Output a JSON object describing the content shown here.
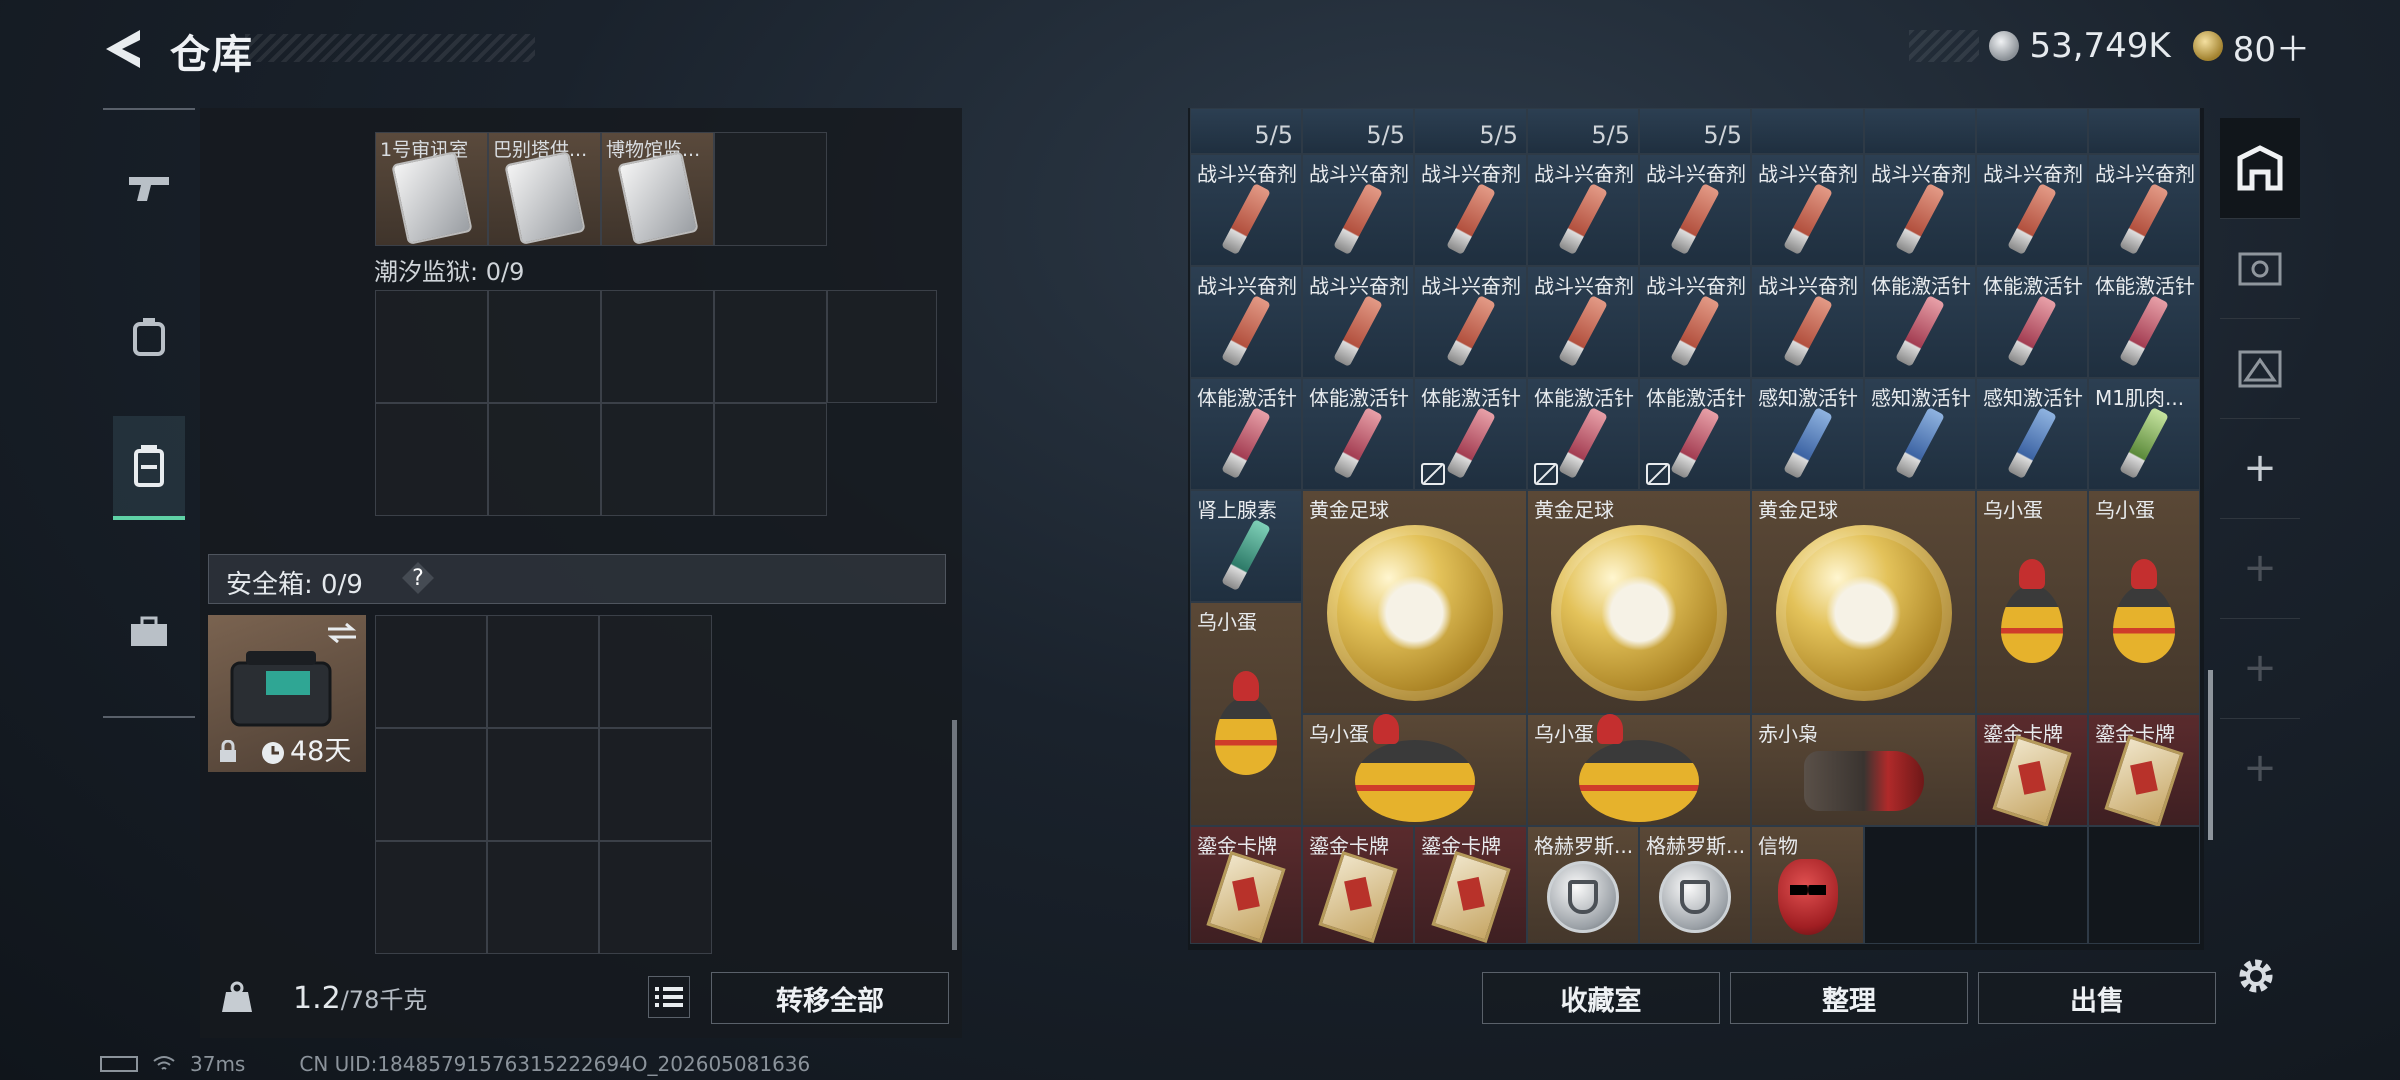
{
  "header": {
    "title": "仓库",
    "currency_silver": "53,749K",
    "currency_gold": "80＋"
  },
  "left": {
    "top_items": [
      "1号审讯室",
      "巴别塔供...",
      "博物馆监..."
    ],
    "section_tide": "潮汐监狱: 0/9",
    "safebox_title": "安全箱: 0/9",
    "help": "?",
    "safebox_timer": "48天",
    "weight_value": "1.2",
    "weight_max": "/78千克",
    "transfer_all": "转移全部"
  },
  "right": {
    "stack_count": "5/5",
    "rows": [
      [
        "战斗兴奋剂",
        "战斗兴奋剂",
        "战斗兴奋剂",
        "战斗兴奋剂",
        "战斗兴奋剂",
        "战斗兴奋剂",
        "战斗兴奋剂",
        "战斗兴奋剂",
        "战斗兴奋剂"
      ],
      [
        "战斗兴奋剂",
        "战斗兴奋剂",
        "战斗兴奋剂",
        "战斗兴奋剂",
        "战斗兴奋剂",
        "战斗兴奋剂",
        "体能激活针",
        "体能激活针",
        "体能激活针"
      ],
      [
        "体能激活针",
        "体能激活针",
        "体能激活针",
        "体能激活针",
        "体能激活针",
        "感知激活针",
        "感知激活针",
        "感知激活针",
        "M1肌肉..."
      ]
    ],
    "adrenaline": "肾上腺素",
    "gold_ball": "黄金足球",
    "egg": "乌小蛋",
    "owl": "赤小枭",
    "card": "鎏金卡牌",
    "griffin": "格赫罗斯...",
    "token": "信物",
    "btn_collection": "收藏室",
    "btn_sort": "整理",
    "btn_sell": "出售"
  },
  "status": {
    "ping": "37ms",
    "uid": "CN UID:18485791576315222694O_202605081636"
  }
}
